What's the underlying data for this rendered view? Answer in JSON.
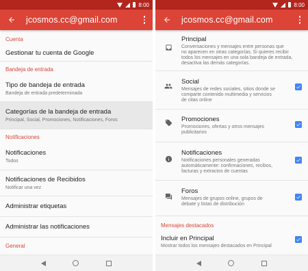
{
  "colors": {
    "appbar": "#db4437",
    "statusbar": "#b3261e",
    "accent": "#db4437",
    "checkbox": "#4285f4"
  },
  "status_time": "8:00",
  "left": {
    "title": "jcosmos.cc@gmail.com",
    "sections": [
      {
        "header": "Cuenta"
      },
      {
        "header": "Bandeja de entrada"
      },
      {
        "header": "Notificaciones"
      },
      {
        "header": "General"
      }
    ],
    "items": [
      {
        "title": "Gestionar tu cuenta de Google",
        "subtitle": ""
      },
      {
        "title": "Tipo de bandeja de entrada",
        "subtitle": "Bandeja de entrada predeterminada"
      },
      {
        "title": "Categorías de la bandeja de entrada",
        "subtitle": "Principal, Social, Promociones, Notificaciones, Foros"
      },
      {
        "title": "Notificaciones",
        "subtitle": "Todos"
      },
      {
        "title": "Notificaciones de Recibidos",
        "subtitle": "Notificar una vez"
      },
      {
        "title": "Administrar etiquetas",
        "subtitle": ""
      },
      {
        "title": "Administrar las notificaciones",
        "subtitle": ""
      }
    ]
  },
  "right": {
    "title": "jcosmos.cc@gmail.com",
    "categories": [
      {
        "icon": "inbox-icon",
        "title": "Principal",
        "desc1": "Conversaciones y mensajes entre personas que",
        "desc2": "no aparecen en otras categorías. Si quieres recibir",
        "desc3": "todos los mensajes en una sola bandeja de entrada,",
        "desc4": "desactiva las demás categorías.",
        "checked": false
      },
      {
        "icon": "people-icon",
        "title": "Social",
        "desc1": "Mensajes de redes sociales, sitios donde se",
        "desc2": "comparte contenido multimedia y servicios",
        "desc3": "de citas online",
        "desc4": "",
        "checked": true
      },
      {
        "icon": "tag-icon",
        "title": "Promociones",
        "desc1": "Promociones, ofertas y otros mensajes",
        "desc2": "publicitarios",
        "desc3": "",
        "desc4": "",
        "checked": true
      },
      {
        "icon": "info-icon",
        "title": "Notificaciones",
        "desc1": "Notificaciones personales generadas",
        "desc2": "automáticamente: confirmaciones, recibos,",
        "desc3": "facturas y extractos de cuentas",
        "desc4": "",
        "checked": true
      },
      {
        "icon": "forum-icon",
        "title": "Foros",
        "desc1": "Mensajes de grupos online, grupos de",
        "desc2": "debate y listas de distribución",
        "desc3": "",
        "desc4": "",
        "checked": true
      }
    ],
    "section_header": "Mensajes destacados",
    "starred": {
      "title": "Incluir en Principal",
      "desc1": "Mostrar todos los mensajes destacados en Principal",
      "checked": true
    }
  }
}
